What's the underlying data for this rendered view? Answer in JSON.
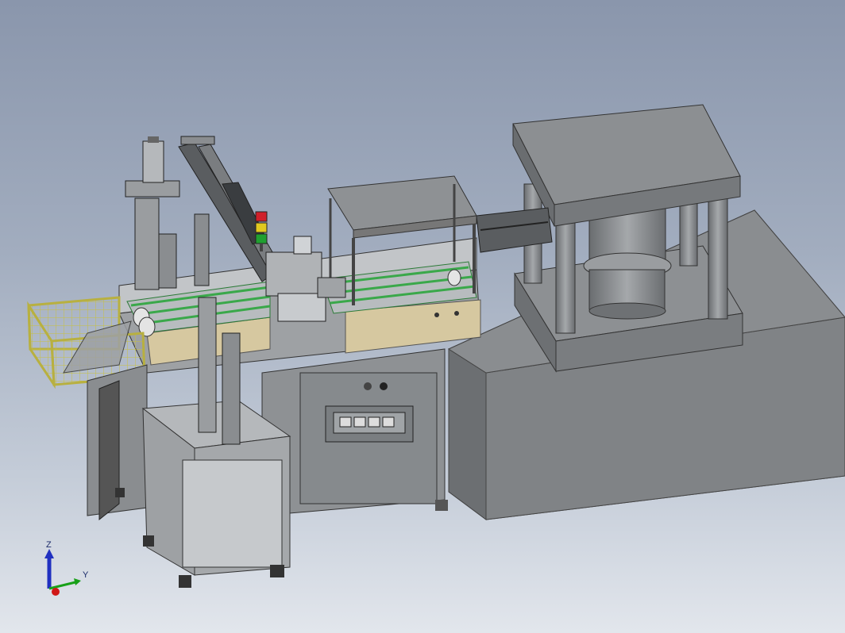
{
  "scene": {
    "description_free": true,
    "colors": {
      "background_top": "#8a96ac",
      "background_bottom": "#e2e6ec",
      "machine_gray": "#8e9194",
      "press_gray": "#7d8083",
      "guard_yellow": "#d8d060",
      "conveyor_green": "#3aa84a",
      "wood_tan": "#d6c8a0",
      "beacon_red": "#d0202a",
      "beacon_yellow": "#e0c820",
      "beacon_green": "#20a030"
    }
  },
  "triad": {
    "z_label": "Z",
    "y_label": "Y",
    "x_color": "#d01818",
    "y_color": "#18a018",
    "z_color": "#2030c0"
  }
}
